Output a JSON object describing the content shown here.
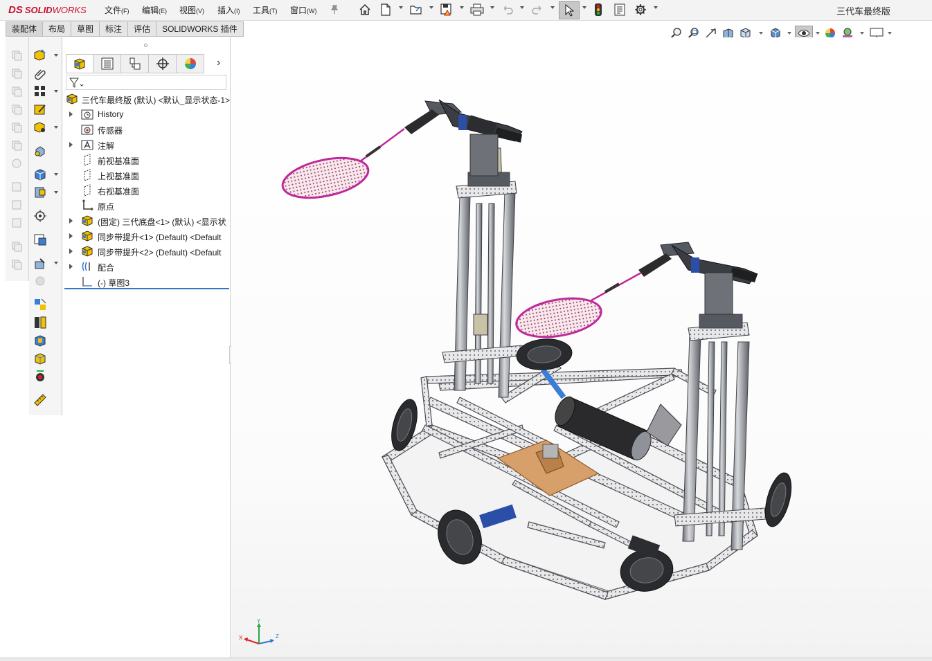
{
  "app": {
    "brand_ds": "DS",
    "brand_solid": "SOLID",
    "brand_works": "WORKS",
    "document_title": "三代车最终版"
  },
  "menu": [
    {
      "label": "文件",
      "key": "(F)"
    },
    {
      "label": "编辑",
      "key": "(E)"
    },
    {
      "label": "视图",
      "key": "(V)"
    },
    {
      "label": "插入",
      "key": "(I)"
    },
    {
      "label": "工具",
      "key": "(T)"
    },
    {
      "label": "窗口",
      "key": "(W)"
    }
  ],
  "toolbar_icons": [
    "home-icon",
    "new-document-icon",
    "open-folder-icon",
    "save-icon",
    "print-icon",
    "undo-icon",
    "redo-icon",
    "select-arrow-icon",
    "traffic-light-icon",
    "file-properties-icon",
    "settings-gear-icon"
  ],
  "command_tabs": [
    "装配体",
    "布局",
    "草图",
    "标注",
    "评估",
    "SOLIDWORKS 插件"
  ],
  "heads_up_icons": [
    "zoom-to-fit-icon",
    "zoom-area-icon",
    "previous-view-icon",
    "section-view-icon",
    "view-orientation-icon",
    "display-style-icon",
    "hide-show-icon",
    "appearance-icon",
    "scene-icon",
    "view-settings-icon"
  ],
  "feature_tree": {
    "tabs": [
      "feature-manager-tab-icon",
      "property-manager-tab-icon",
      "configuration-manager-tab-icon",
      "dimxpert-tab-icon",
      "display-manager-tab-icon"
    ],
    "root": "三代车最终版 (默认) <默认_显示状态-1>",
    "items": [
      {
        "label": "History",
        "expandable": true,
        "icon": "history-folder-icon"
      },
      {
        "label": "传感器",
        "expandable": false,
        "icon": "sensors-icon"
      },
      {
        "label": "注解",
        "expandable": true,
        "icon": "annotations-icon"
      },
      {
        "label": "前视基准面",
        "expandable": false,
        "icon": "plane-icon"
      },
      {
        "label": "上视基准面",
        "expandable": false,
        "icon": "plane-icon"
      },
      {
        "label": "右视基准面",
        "expandable": false,
        "icon": "plane-icon"
      },
      {
        "label": "原点",
        "expandable": false,
        "icon": "origin-icon"
      },
      {
        "label": "(固定) 三代底盘<1> (默认) <显示状",
        "expandable": true,
        "icon": "subassembly-icon"
      },
      {
        "label": "同步带提升<1> (Default) <Default",
        "expandable": true,
        "icon": "subassembly-icon"
      },
      {
        "label": "同步带提升<2> (Default) <Default",
        "expandable": true,
        "icon": "subassembly-icon"
      },
      {
        "label": "配合",
        "expandable": true,
        "icon": "mates-icon"
      },
      {
        "label": "(-) 草图3",
        "expandable": false,
        "icon": "sketch-icon"
      }
    ]
  },
  "triad": {
    "x": "X",
    "y": "Y",
    "z": "Z"
  },
  "colors": {
    "brand_red": "#c8102e",
    "selection_blue": "#2e78c7",
    "frame_gray": "#8f9399",
    "racket_magenta": "#c0289a",
    "plate_tan": "#d7a06a"
  }
}
